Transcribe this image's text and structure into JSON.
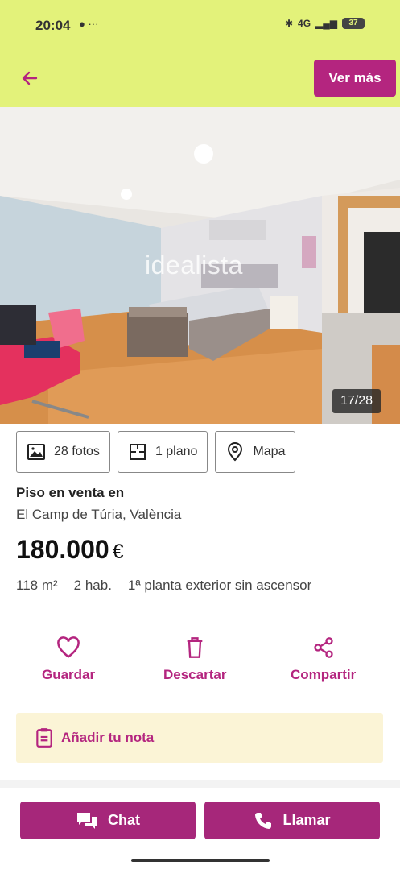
{
  "status_bar": {
    "time": "20:04",
    "left_icons": "● ···",
    "signal": "4G",
    "battery": "37"
  },
  "header": {
    "back_icon": "arrow-left-icon",
    "ver_mas": "Ver más",
    "bg_color": "#e3f27a",
    "accent": "#b4257f"
  },
  "photo": {
    "watermark": "idealista",
    "counter": "17/28"
  },
  "chips": [
    {
      "icon": "image-icon",
      "label": "28 fotos"
    },
    {
      "icon": "floorplan-icon",
      "label": "1 plano"
    },
    {
      "icon": "map-pin-icon",
      "label": "Mapa"
    }
  ],
  "listing": {
    "title": "Piso en venta en",
    "location": "El Camp de Túria, València",
    "price": "180.000",
    "currency": "€",
    "area": "118 m²",
    "rooms": "2 hab.",
    "floor": "1ª planta exterior sin ascensor"
  },
  "actions": {
    "save": "Guardar",
    "discard": "Descartar",
    "share": "Compartir"
  },
  "note": {
    "label": "Añadir tu nota"
  },
  "bottom": {
    "chat": "Chat",
    "call": "Llamar"
  }
}
